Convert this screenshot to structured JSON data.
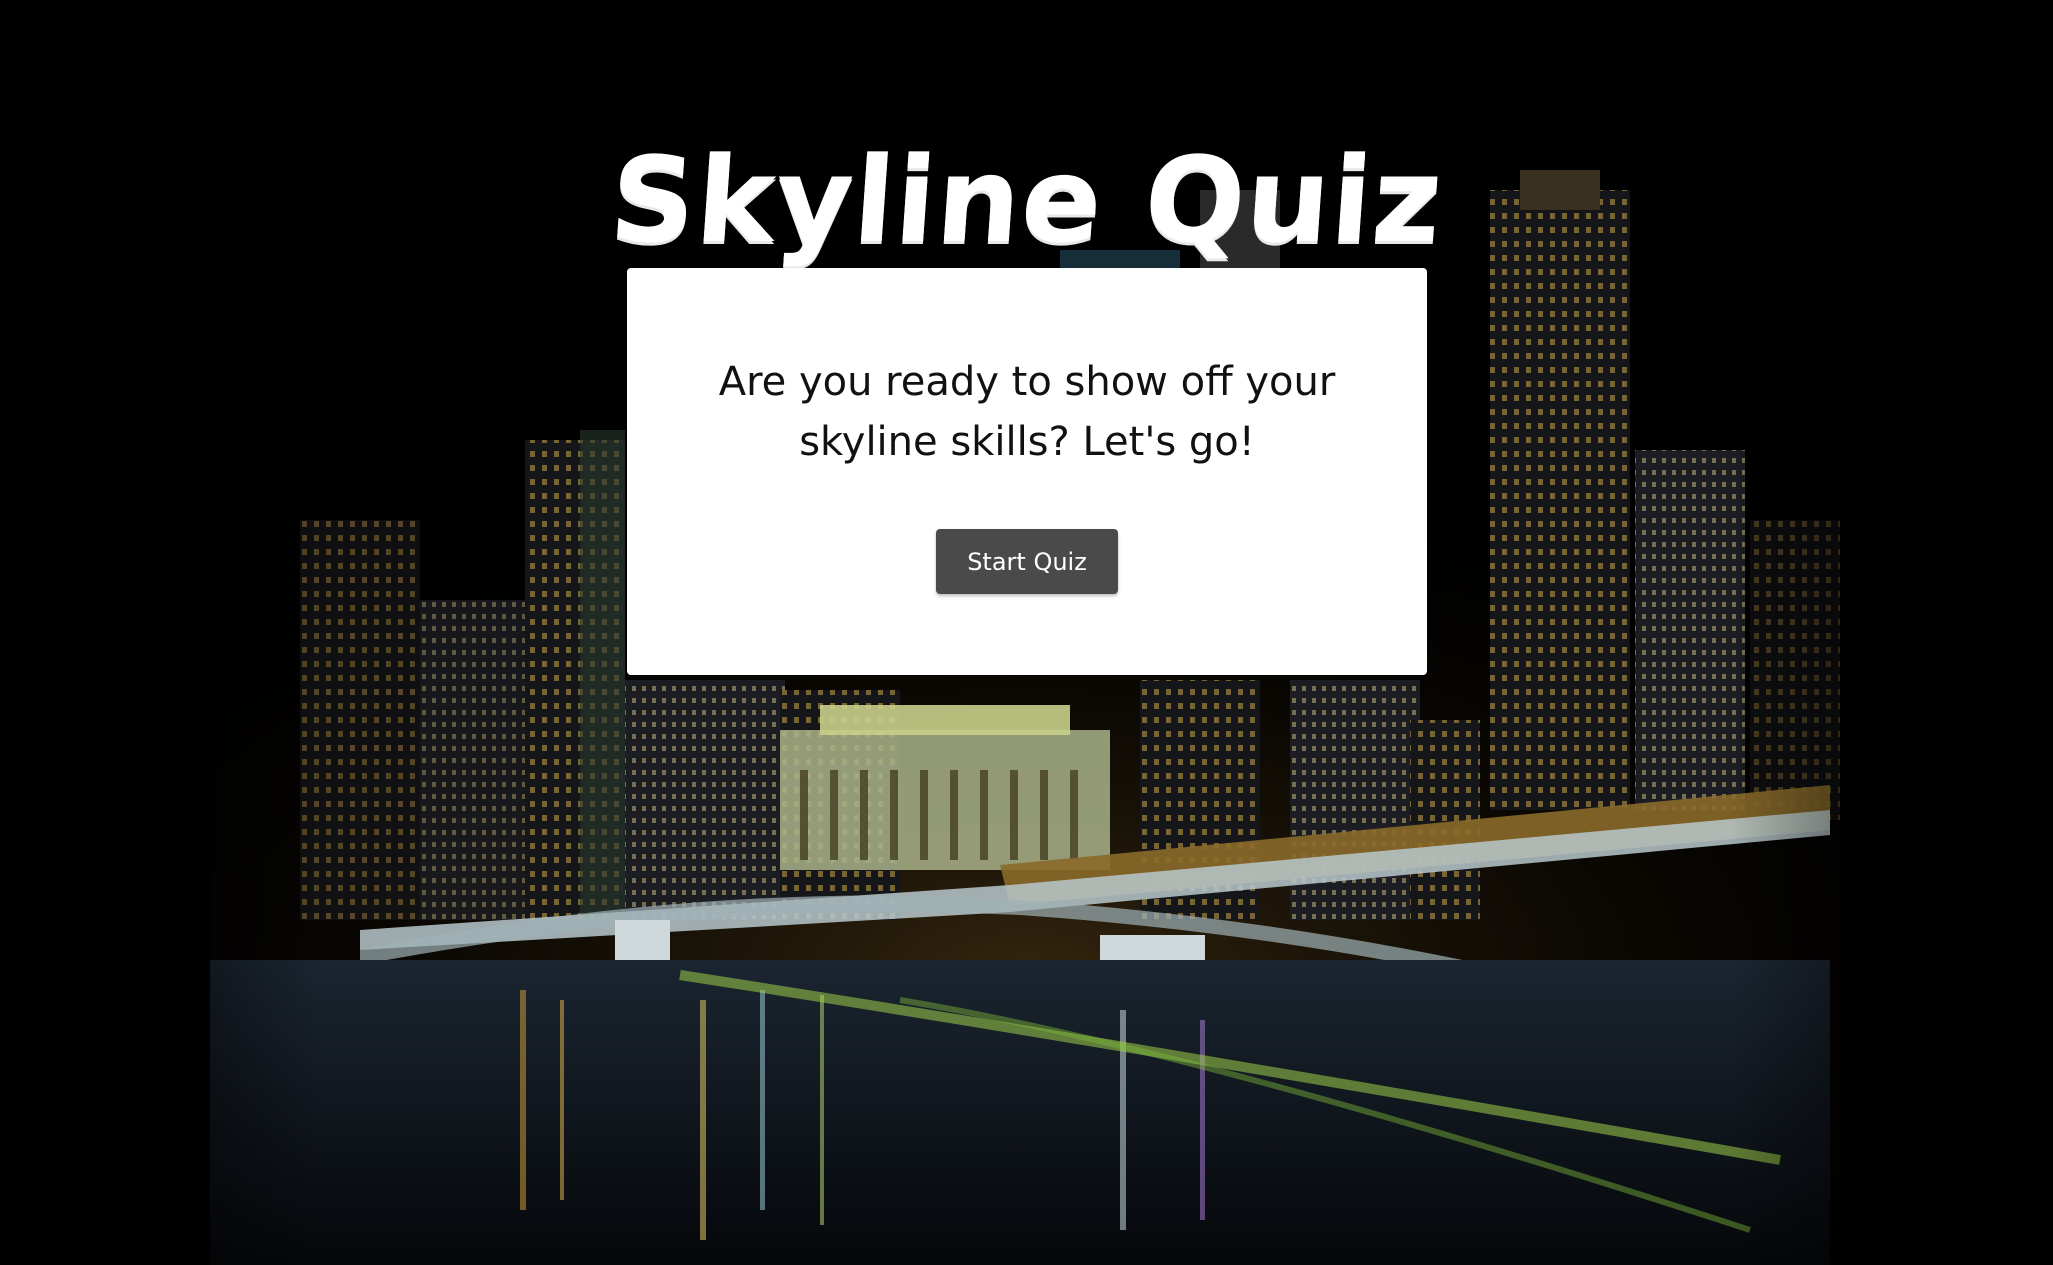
{
  "header": {
    "title": "Skyline Quiz"
  },
  "intro": {
    "prompt": "Are you ready to show off your skyline skills? Let's go!",
    "start_label": "Start Quiz"
  },
  "theme": {
    "background": "#000000",
    "card_background": "#ffffff",
    "button_background": "#4a4a4a",
    "button_text": "#ffffff"
  },
  "background_image": {
    "icon": "night-city-skyline-with-bridge-image"
  }
}
